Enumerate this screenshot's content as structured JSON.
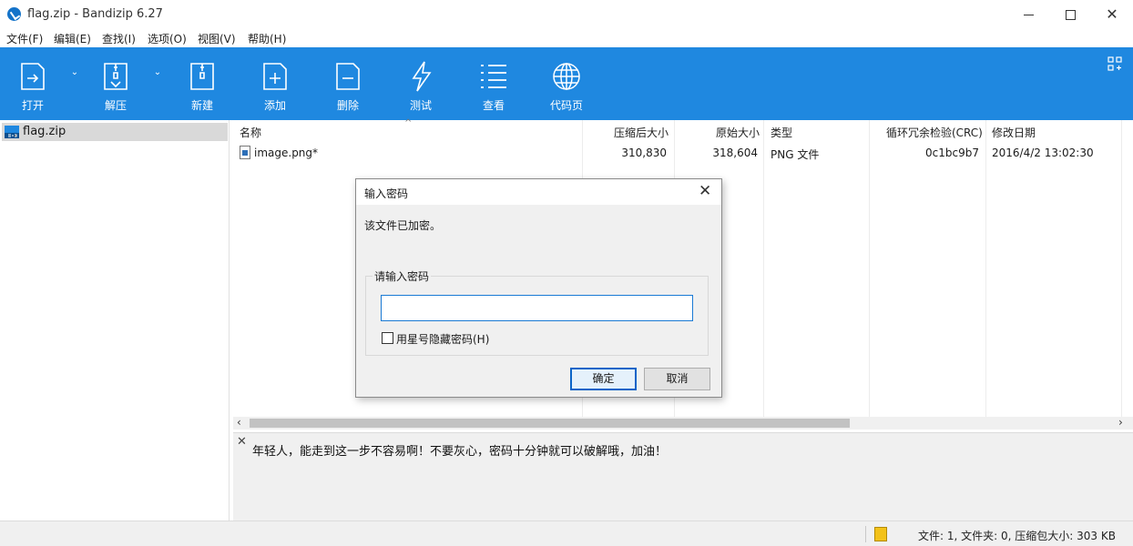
{
  "window": {
    "title": "flag.zip - Bandizip 6.27"
  },
  "menu": [
    "文件(F)",
    "编辑(E)",
    "查找(I)",
    "选项(O)",
    "视图(V)",
    "帮助(H)"
  ],
  "toolbar": {
    "open": "打开",
    "extract": "解压",
    "new": "新建",
    "add": "添加",
    "delete": "删除",
    "test": "测试",
    "view": "查看",
    "codepage": "代码页"
  },
  "tree": {
    "root": "flag.zip"
  },
  "columns": {
    "name": "名称",
    "compressed": "压缩后大小",
    "original": "原始大小",
    "type": "类型",
    "crc": "循环冗余检验(CRC)",
    "modified": "修改日期"
  },
  "files": [
    {
      "name": "image.png*",
      "compressed": "310,830",
      "original": "318,604",
      "type": "PNG 文件",
      "crc": "0c1bc9b7",
      "modified": "2016/4/2 13:02:30"
    }
  ],
  "comment": {
    "text": "年轻人，能走到这一步不容易啊！不要灰心，密码十分钟就可以破解哦，加油！"
  },
  "status": {
    "text": "文件: 1, 文件夹: 0, 压缩包大小: 303 KB"
  },
  "dialog": {
    "title": "输入密码",
    "message": "该文件已加密。",
    "group_label": "请输入密码",
    "password_value": "",
    "hide_label": "用星号隐藏密码(H)",
    "hide_checked": false,
    "ok": "确定",
    "cancel": "取消"
  },
  "colors": {
    "toolbar_bg": "#1f88e0",
    "accent": "#0a64c8"
  }
}
